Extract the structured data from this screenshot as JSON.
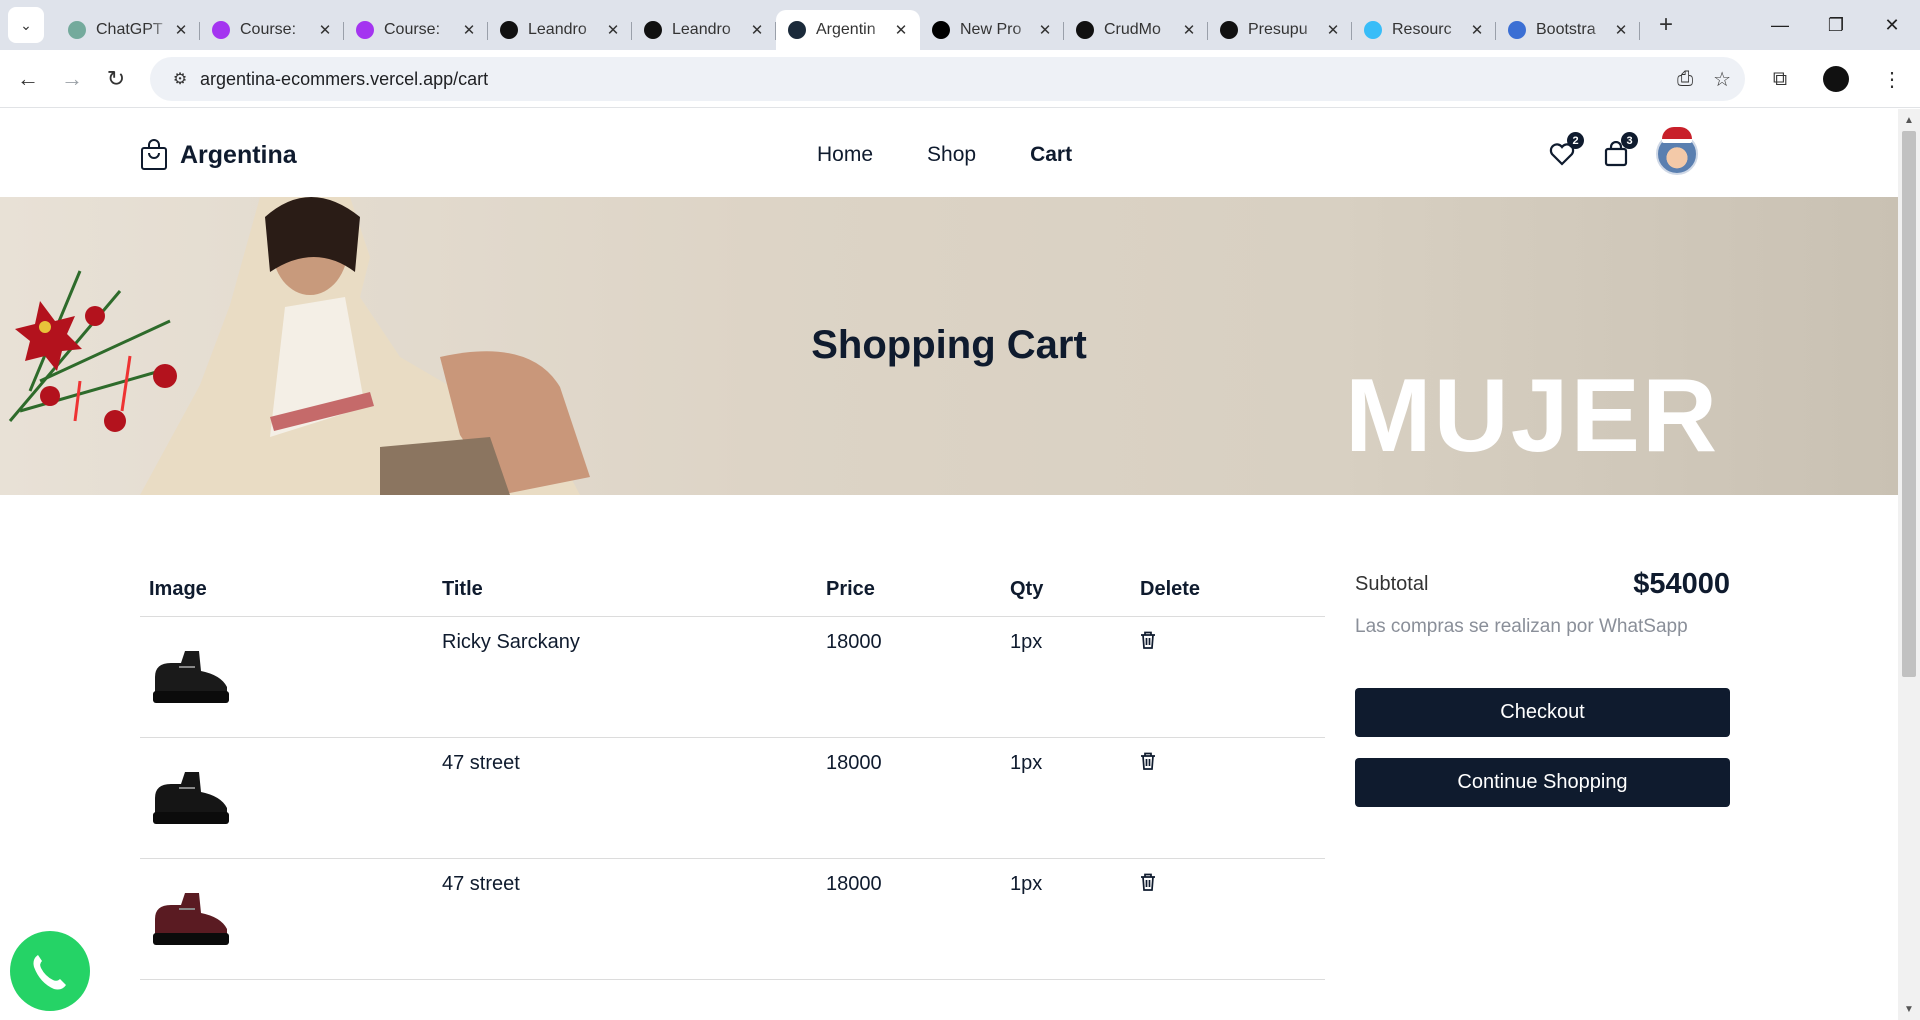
{
  "browser": {
    "tabs": [
      {
        "title": "ChatGPT",
        "favicon_color": "#74aa9c",
        "favicon_name": "chatgpt-icon"
      },
      {
        "title": "Course: ",
        "favicon_color": "#a435f0",
        "favicon_name": "udemy-icon"
      },
      {
        "title": "Course: ",
        "favicon_color": "#a435f0",
        "favicon_name": "udemy-icon"
      },
      {
        "title": "Leandro",
        "favicon_color": "#111111",
        "favicon_name": "medium-icon"
      },
      {
        "title": "Leandro",
        "favicon_color": "#111111",
        "favicon_name": "github-icon"
      },
      {
        "title": "Argentin",
        "favicon_color": "#1b2a3a",
        "favicon_name": "react-icon",
        "active": true
      },
      {
        "title": "New Pro",
        "favicon_color": "#000000",
        "favicon_name": "vercel-icon"
      },
      {
        "title": "CrudMo",
        "favicon_color": "#111111",
        "favicon_name": "angular-icon"
      },
      {
        "title": "Presupu",
        "favicon_color": "#111111",
        "favicon_name": "angular-icon"
      },
      {
        "title": "Resourc",
        "favicon_color": "#38bdf8",
        "favicon_name": "tailwind-icon"
      },
      {
        "title": "Bootstra",
        "favicon_color": "#3b6fd4",
        "favicon_name": "flag-icon"
      }
    ],
    "url": "argentina-ecommers.vercel.app/cart"
  },
  "nav": {
    "brand": "Argentina",
    "links": [
      "Home",
      "Shop",
      "Cart"
    ],
    "active_link": "Cart",
    "wishlist_count": "2",
    "cart_count": "3"
  },
  "hero": {
    "title": "Shopping Cart",
    "banner_text": "MUJER"
  },
  "table": {
    "headers": [
      "Image",
      "Title",
      "Price",
      "Qty",
      "Delete"
    ],
    "rows": [
      {
        "title": "Ricky Sarckany",
        "price": "18000",
        "qty": "1px",
        "shoe_color": "#1a1a1a"
      },
      {
        "title": "47 street",
        "price": "18000",
        "qty": "1px",
        "shoe_color": "#151515"
      },
      {
        "title": "47 street",
        "price": "18000",
        "qty": "1px",
        "shoe_color": "#5a1b22"
      }
    ]
  },
  "summary": {
    "subtotal_label": "Subtotal",
    "subtotal_value": "$54000",
    "note": "Las compras se realizan por WhatSapp",
    "checkout": "Checkout",
    "continue": "Continue Shopping"
  },
  "colors": {
    "primary": "#0f1b2e",
    "whatsapp": "#25d366"
  }
}
